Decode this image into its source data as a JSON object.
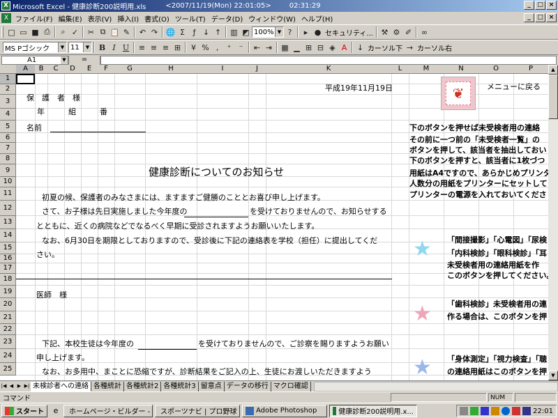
{
  "window": {
    "title": "Microsoft Excel - 健康診断200説明用.xls",
    "date": "<2007/11/19(Mon) 22:01:05>",
    "time": "02:31:29",
    "buttons": [
      "_",
      "□",
      "×"
    ]
  },
  "menubar": {
    "items": [
      "ファイル(F)",
      "編集(E)",
      "表示(V)",
      "挿入(I)",
      "書式(O)",
      "ツール(T)",
      "データ(D)",
      "ウィンドウ(W)",
      "ヘルプ(H)"
    ],
    "doc_buttons": [
      "_",
      "□",
      "×"
    ]
  },
  "toolbar1": {
    "zoom": "100%",
    "security": "セキュリティ..."
  },
  "toolbar2": {
    "font": "MS Pゴシック",
    "size": "11",
    "bold": "B",
    "italic": "I",
    "underline": "U",
    "percent": "%",
    "comma": ",",
    "cursor_down": "カーソル下",
    "cursor_right": "カーソル右"
  },
  "formula": {
    "name_box": "A1",
    "eq": "=",
    "value": ""
  },
  "columns": [
    "A",
    "B",
    "C",
    "D",
    "E",
    "F",
    "G",
    "H",
    "I",
    "J",
    "K",
    "L",
    "M",
    "N",
    "O",
    "P"
  ],
  "rows": [
    "1",
    "2",
    "3",
    "4",
    "5",
    "6",
    "7",
    "8",
    "9",
    "10",
    "11",
    "12",
    "13",
    "14",
    "15",
    "16",
    "17",
    "18",
    "19",
    "20",
    "21",
    "22",
    "23",
    "24",
    "25"
  ],
  "cells": {
    "date": "平成19年11月19日",
    "guardian": "保　護　者　様",
    "year": "年",
    "class": "組",
    "number": "番",
    "name": "名前",
    "doc_title": "健康診断についてのお知らせ",
    "p1": "初夏の候、保護者のみなさまには、ますますご健勝のこととお喜び申し上げます。",
    "p2a": "さて、お子様は先日実施しました今年度の",
    "p2b": "を受けておりませんので、お知らせする",
    "p3": "とともに、近くの病院などでなるべく早期に受診されますようお願いいたします。",
    "p4": "なお、6月30日を期限としておりますので、受診後に下記の連絡表を学校（担任）に提出してくだ",
    "p5": "さい。",
    "doctor": "医師　様",
    "p6a": "下記、本校生徒は今年度の",
    "p6b": "を受けておりませんので、ご診察を賜りますようお願い",
    "p7": "申し上げます。",
    "p8": "なお、お多用中、まことに恐縮ですが、診断結果をご記入の上、生徒にお渡しいただきますよう"
  },
  "side": {
    "menu_return": "メニューに戻る",
    "instr1": "下のボタンを押せば未受検者用の連絡",
    "instr2": "その前に一つ前の「未受検者一覧」の",
    "instr3": "ボタンを押して、該当者を抽出しておい",
    "instr4": "下のボタンを押すと、該当者に1枚づつ",
    "instr5": "用紙はA4ですので、あらかじめプリンタ",
    "instr6": "人数分の用紙をプリンターにセットして",
    "instr7": "プリンターの電源を入れておいてくださ",
    "b1_1": "「間接撮影」「心電図」「尿検",
    "b1_2": "「内科検診」「眼科検診」「耳",
    "b1_3": "未受検者用の連絡用紙を作",
    "b1_4": "このボタンを押してください。",
    "b2_1": "「歯科検診」未受検者用の連",
    "b2_2": "作る場合は、このボタンを押",
    "b3_1": "「身体測定」「視力検査」「聴",
    "b3_2": "の連絡用紙はこのボタンを押"
  },
  "tabs": [
    "未検診者への連絡",
    "各種統計",
    "各種統計2",
    "各種統計3",
    "留意点",
    "データの移行",
    "マクロ確認"
  ],
  "status": {
    "mode": "コマンド",
    "num": "NUM"
  },
  "taskbar": {
    "start": "スタート",
    "tasks": [
      "ホームページ・ビルダー - [",
      "スポーツナビ | プロ野球 |",
      "Adobe Photoshop",
      "健康診断200説明用.x..."
    ],
    "clock": "22:01"
  },
  "colors": {
    "title_gradient_start": "#0a246a",
    "title_gradient_end": "#a6caf0",
    "star1": "#8fd9f0",
    "star2": "#f0a6b8",
    "star3": "#9ab8e8",
    "menu_icon": "#d03020"
  }
}
